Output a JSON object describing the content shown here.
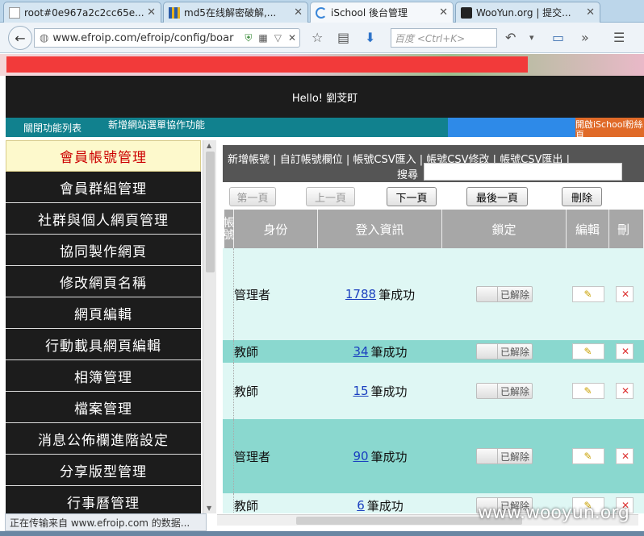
{
  "tabs": [
    {
      "title": "root#0e967a2c2cc65e...",
      "icon": "page-icon"
    },
    {
      "title": "md5在线解密破解,...",
      "icon": "grid-favicon"
    },
    {
      "title": "iSchool 後台管理",
      "icon": "loading-icon",
      "active": true
    },
    {
      "title": "WooYun.org | 提交...",
      "icon": "wooyun-favicon"
    }
  ],
  "nav": {
    "url": "www.efroip.com/efroip/config/boar",
    "search_placeholder": "百度 <Ctrl+K>"
  },
  "page": {
    "hello": "Hello! 劉芠町",
    "menu_toggle": "關閉功能列表",
    "add_menu_collab": "新增網站選單協作功能",
    "open_ischool": "開啟iSchool粉絲頁",
    "colors": {
      "accent_red": "#f23a3a",
      "teal": "#11818e",
      "blue": "#2e8ae8",
      "orange": "#e06a28"
    }
  },
  "sidebar": {
    "items": [
      {
        "label": "會員帳號管理",
        "active": true
      },
      {
        "label": "會員群組管理"
      },
      {
        "label": "社群與個人網頁管理"
      },
      {
        "label": "協同製作網頁"
      },
      {
        "label": "修改網頁名稱"
      },
      {
        "label": "網頁編輯"
      },
      {
        "label": "行動載具網頁編輯"
      },
      {
        "label": "相簿管理"
      },
      {
        "label": "檔案管理"
      },
      {
        "label": "消息公佈欄進階設定"
      },
      {
        "label": "分享版型管理"
      },
      {
        "label": "行事曆管理"
      }
    ]
  },
  "toolbar": {
    "add_account": "新增帳號",
    "custom_fields": "自訂帳號欄位",
    "csv_import": "帳號CSV匯入",
    "csv_modify": "帳號CSV修改",
    "csv_export": "帳號CSV匯出",
    "sep": "|",
    "search_label": "搜尋"
  },
  "pager": {
    "first": "第一頁",
    "prev": "上一頁",
    "next": "下一頁",
    "last": "最後一頁",
    "delete": "刪除"
  },
  "table": {
    "headers": {
      "account": "帳號",
      "role": "身份",
      "login": "登入資訊",
      "lock": "鎖定",
      "edit": "編輯",
      "delete": "刪"
    },
    "success_suffix": "筆成功",
    "lock_label": "已解除",
    "rows": [
      {
        "role": "管理者",
        "login_count": "1788"
      },
      {
        "role": "教師",
        "login_count": "34"
      },
      {
        "role": "教師",
        "login_count": "15"
      },
      {
        "role": "管理者",
        "login_count": "90"
      },
      {
        "role": "教師",
        "login_count": "6"
      }
    ]
  },
  "status": "正在传输来自 www.efroip.com 的数据...",
  "watermark": "www.wooyun.org"
}
